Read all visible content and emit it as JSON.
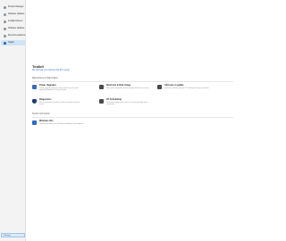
{
  "sidebar": {
    "items": [
      {
        "label": "Product Manager",
        "icon": "box-icon",
        "active": false
      },
      {
        "label": "Software Updates",
        "icon": "refresh-icon",
        "active": false
      },
      {
        "label": "Installed Drivers",
        "icon": "chip-icon",
        "active": false
      },
      {
        "label": "Software Updates",
        "icon": "download-icon",
        "active": false
      },
      {
        "label": "Recommendations",
        "icon": "star-icon",
        "active": false
      },
      {
        "label": "Toolkit",
        "icon": "wrench-icon",
        "active": true
      }
    ],
    "bottom_label": "Settings"
  },
  "main": {
    "title": "Toolkit",
    "subtitle": "We can help you improve this PC's setup",
    "sections": [
      {
        "header": "Maintenance & Optimization",
        "tools": [
          {
            "title": "Power Upgrades",
            "description": "Power upgrades give you more helpful tips to ensure optimal performance for your device",
            "icon": "power-icon",
            "color": "#3a6db5"
          },
          {
            "title": "Shortcuts & Disk Usage",
            "description": "Get a quick snapshot of your storage and clean up space",
            "icon": "disk-icon",
            "color": "#4a4a4a"
          },
          {
            "title": "Add new or update",
            "description": "Find new software for your PC and keep all apps up to date",
            "icon": "plus-icon",
            "color": "#4a4a4a"
          },
          {
            "title": "Diagnostics",
            "description": "Run a quick check to detect and fix common hardware issues",
            "icon": "shield-icon",
            "color": "#1f3e6e"
          },
          {
            "title": "PC Scheduling",
            "description": "Schedule maintenance tasks to run automatically when convenient",
            "icon": "calendar-icon",
            "color": "#4a4a4a"
          }
        ]
      },
      {
        "header": "System Information",
        "tools": [
          {
            "title": "Windows Info",
            "description": "View details about your Windows installation and hardware",
            "icon": "windows-icon",
            "color": "#2b6cc4"
          }
        ]
      }
    ]
  }
}
